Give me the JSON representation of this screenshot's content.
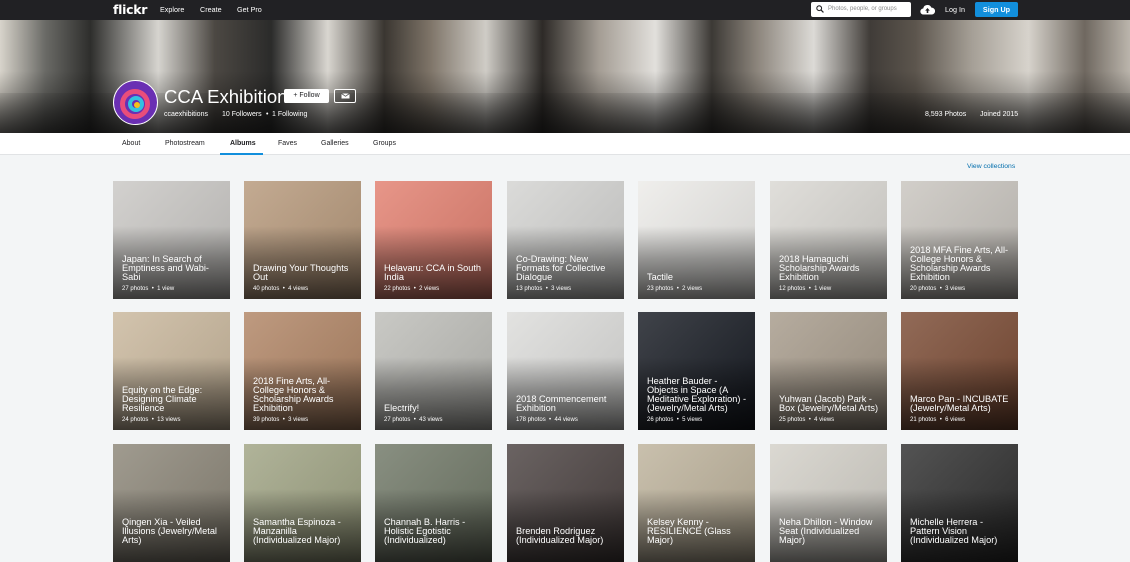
{
  "nav": {
    "logo": "flickr",
    "explore": "Explore",
    "create": "Create",
    "get_pro": "Get Pro",
    "search_placeholder": "Photos, people, or groups",
    "login": "Log In",
    "signup": "Sign Up"
  },
  "profile": {
    "title": "CCA Exhibitions",
    "follow_label": "Follow",
    "username": "ccaexhibitions",
    "followers": "10 Followers",
    "following": "1 Following",
    "photos": "8,593 Photos",
    "joined": "Joined 2015"
  },
  "tabs": [
    "About",
    "Photostream",
    "Albums",
    "Faves",
    "Galleries",
    "Groups"
  ],
  "active_tab": "Albums",
  "view_collections": "View collections",
  "albums": [
    {
      "title": "Japan: In Search of Emptiness and Wabi-Sabi",
      "photos": "27 photos",
      "views": "1 view",
      "bg": "#c9c7c4"
    },
    {
      "title": "Drawing Your Thoughts Out",
      "photos": "40 photos",
      "views": "4 views",
      "bg": "#b6987a"
    },
    {
      "title": "Helavaru: CCA in South India",
      "photos": "22 photos",
      "views": "2 views",
      "bg": "#e27f6f"
    },
    {
      "title": "Co-Drawing: New Formats for Collective Dialogue",
      "photos": "13 photos",
      "views": "3 views",
      "bg": "#d3d3d1"
    },
    {
      "title": "Tactile",
      "photos": "23 photos",
      "views": "2 views",
      "bg": "#ecebe8"
    },
    {
      "title": "2018 Hamaguchi Scholarship Awards Exhibition",
      "photos": "12 photos",
      "views": "1 view",
      "bg": "#d9d7d2"
    },
    {
      "title": "2018 MFA Fine Arts, All-College Honors & Scholarship Awards Exhibition",
      "photos": "20 photos",
      "views": "3 views",
      "bg": "#c8c4be"
    },
    {
      "title": "Equity on the Edge: Designing Climate Resilience",
      "photos": "24 photos",
      "views": "13 views",
      "bg": "#c9b79c"
    },
    {
      "title": "2018 Fine Arts, All-College Honors & Scholarship Awards Exhibition",
      "photos": "39 photos",
      "views": "3 views",
      "bg": "#b08464"
    },
    {
      "title": "Electrify!",
      "photos": "27 photos",
      "views": "43 views",
      "bg": "#bdbdb8"
    },
    {
      "title": "2018 Commencement Exhibition",
      "photos": "178 photos",
      "views": "44 views",
      "bg": "#dcdcda"
    },
    {
      "title": "Heather Bauder - Objects in Space (A Meditative Exploration) - (Jewelry/Metal Arts)",
      "photos": "26 photos",
      "views": "5 views",
      "bg": "#161a22"
    },
    {
      "title": "Yuhwan (Jacob) Park - Box (Jewelry/Metal Arts)",
      "photos": "25 photos",
      "views": "4 views",
      "bg": "#a69a8a"
    },
    {
      "title": "Marco Pan - INCUBATE (Jewelry/Metal Arts)",
      "photos": "21 photos",
      "views": "6 views",
      "bg": "#7a4a33"
    },
    {
      "title": "Qingen Xia - Veiled Illusions (Jewelry/Metal Arts)",
      "photos": "",
      "views": "",
      "bg": "#8b8577"
    },
    {
      "title": "Samantha Espinoza - Manzanilla (Individualized Major)",
      "photos": "",
      "views": "",
      "bg": "#9fa383"
    },
    {
      "title": "Channah B. Harris - Holistic Egotistic (Individualized)",
      "photos": "",
      "views": "",
      "bg": "#6f7766"
    },
    {
      "title": "Brenden Rodriguez (Individualized Major)",
      "photos": "",
      "views": "",
      "bg": "#4a4140"
    },
    {
      "title": "Kelsey Kenny - RESILIENCE (Glass Major)",
      "photos": "",
      "views": "",
      "bg": "#bdb29b"
    },
    {
      "title": "Neha Dhillon - Window Seat (Individualized Major)",
      "photos": "",
      "views": "",
      "bg": "#d3d0c8"
    },
    {
      "title": "Michelle Herrera - Pattern Vision (Individualized Major)",
      "photos": "",
      "views": "",
      "bg": "#2e2e2e"
    }
  ]
}
